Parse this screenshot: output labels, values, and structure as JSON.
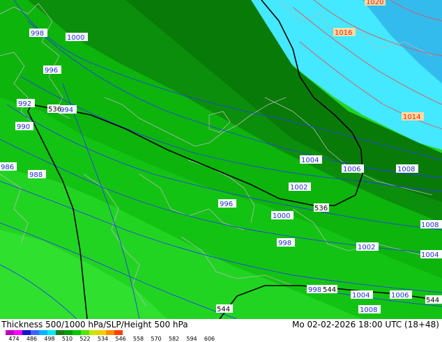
{
  "title": "Thickness 500/1000 hPa/SLP/Height 500 hPa",
  "valid_time": "Mo 02-02-2026 18:00 UTC (18+48)",
  "legend": {
    "ticks": [
      "474",
      "486",
      "498",
      "510",
      "522",
      "534",
      "546",
      "558",
      "570",
      "582",
      "594",
      "606"
    ],
    "colors": [
      "#c000c0",
      "#ff00ff",
      "#1414c8",
      "#3c64ff",
      "#00b4ff",
      "#00e8ff",
      "#1a7a1a",
      "#0a9a0a",
      "#00c800",
      "#50e600",
      "#c8e600",
      "#f0d000",
      "#ff8c00",
      "#ff4000"
    ]
  },
  "labels": {
    "slp_blue": [
      "998",
      "1000",
      "996",
      "992",
      "994",
      "990",
      "986",
      "988",
      "1004",
      "1006",
      "1008",
      "1002",
      "996",
      "1000",
      "998",
      "1008",
      "1002",
      "1004",
      "998",
      "1004",
      "1006",
      "1008"
    ],
    "slp_red": [
      "1020",
      "1016",
      "1014"
    ],
    "height_black": [
      "536",
      "536",
      "544",
      "544",
      "544"
    ]
  }
}
